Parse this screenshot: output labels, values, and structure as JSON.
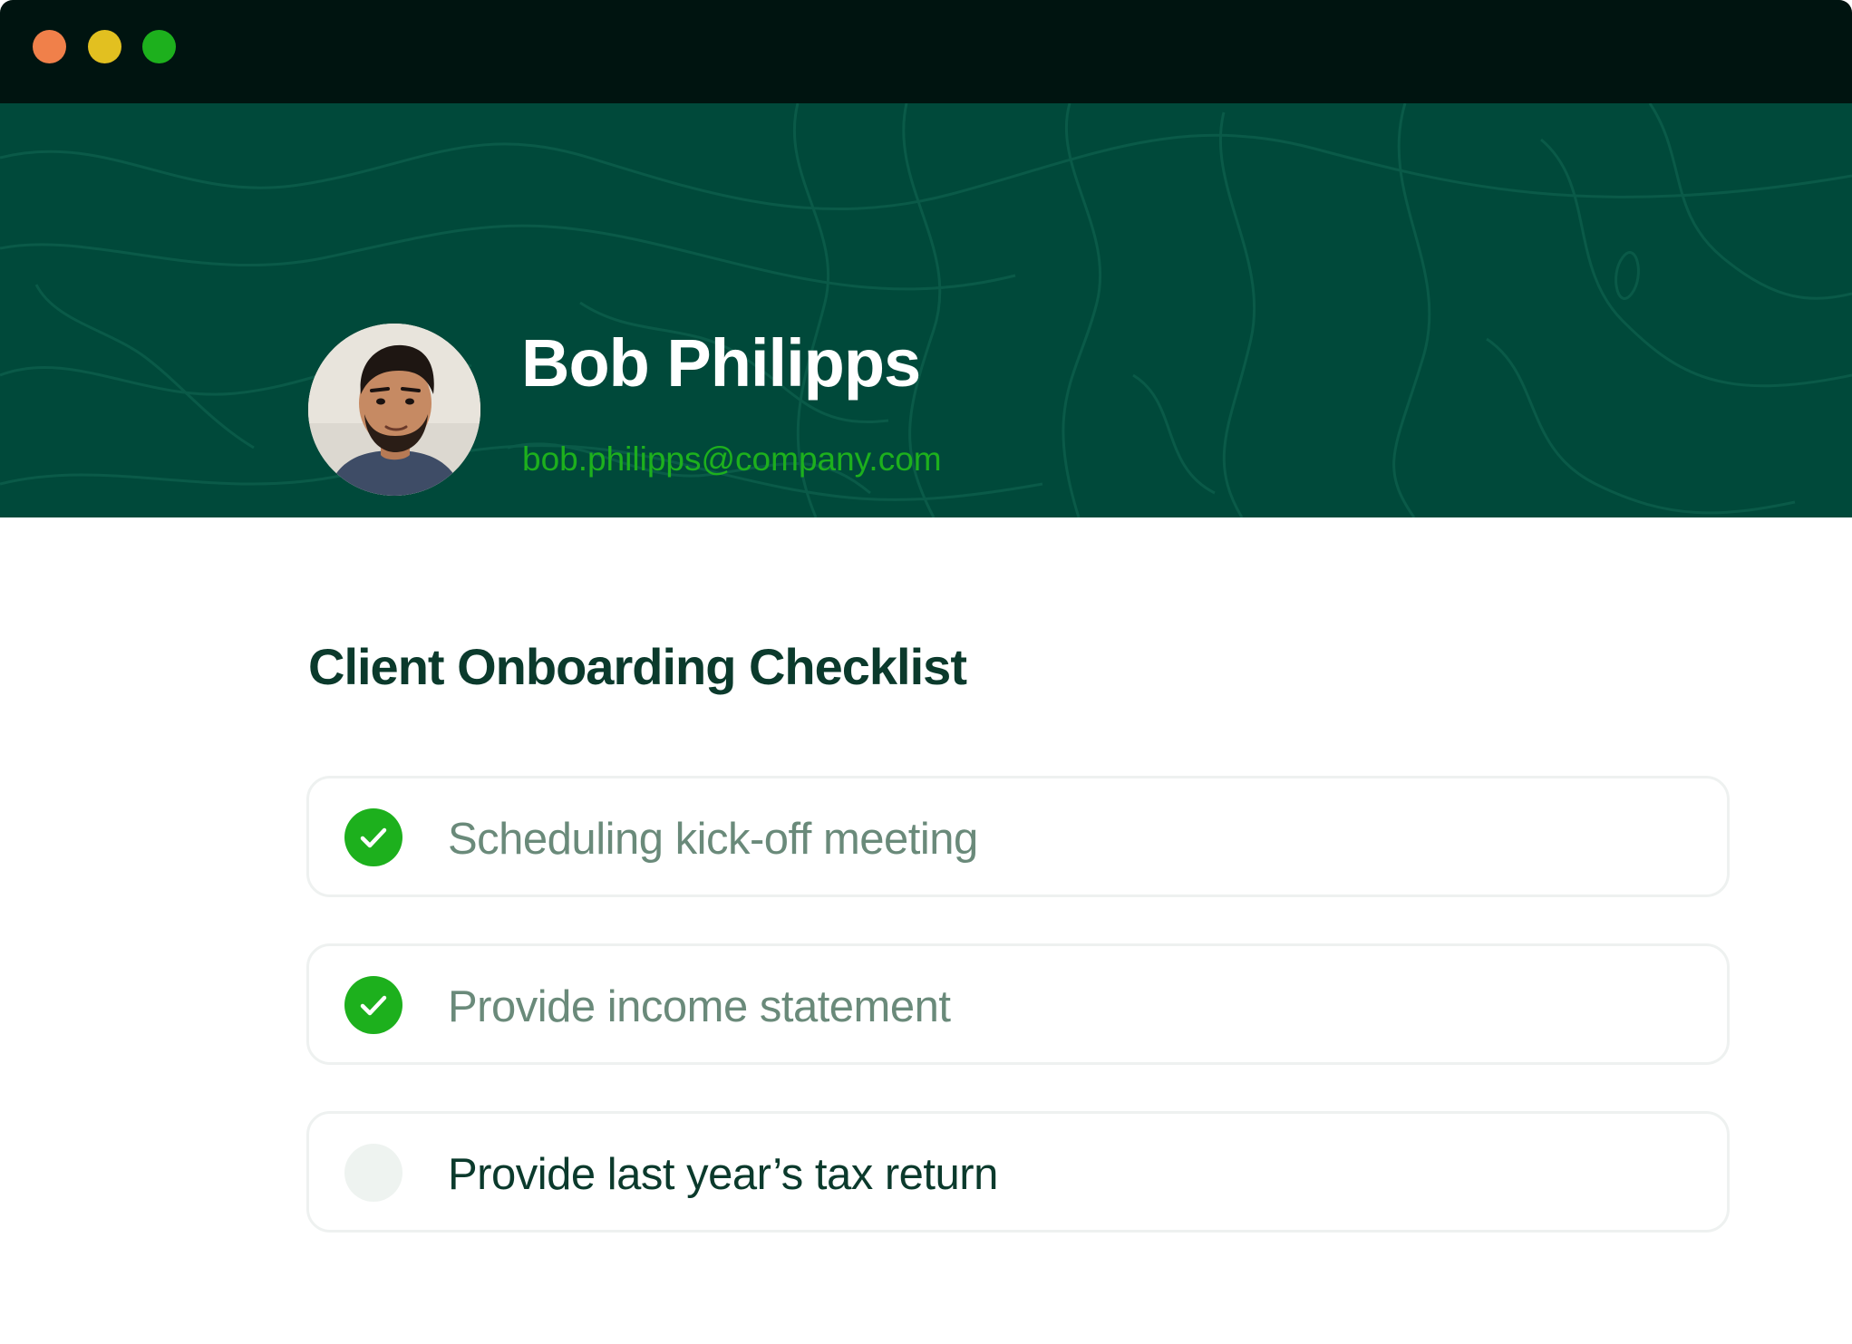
{
  "window": {
    "controls": [
      {
        "name": "close",
        "color": "#f0804a"
      },
      {
        "name": "minimize",
        "color": "#e2c020"
      },
      {
        "name": "maximize",
        "color": "#1db01d"
      }
    ]
  },
  "colors": {
    "banner_bg": "#00493a",
    "banner_lines": "#0a5a48",
    "accent_green": "#1db01d",
    "heading": "#0b3a2c",
    "completed_text": "#6a8a7a",
    "pending_text": "#0b3a2c",
    "pending_circle": "#eef3f0"
  },
  "profile": {
    "name": "Bob Philipps",
    "email": "bob.philipps@company.com",
    "avatar_icon": "user-photo"
  },
  "checklist": {
    "title": "Client Onboarding Checklist",
    "items": [
      {
        "label": "Scheduling kick-off meeting",
        "completed": true,
        "icon": "check-icon"
      },
      {
        "label": "Provide income statement",
        "completed": true,
        "icon": "check-icon"
      },
      {
        "label": "Provide last year’s tax return",
        "completed": false,
        "icon": "empty-circle-icon"
      }
    ]
  }
}
